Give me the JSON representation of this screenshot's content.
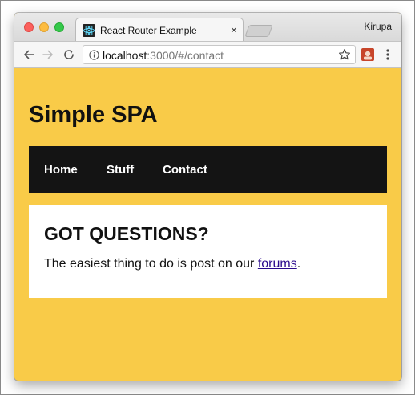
{
  "browser": {
    "tab": {
      "title": "React Router Example",
      "close_glyph": "×",
      "icon": "react-favicon-icon"
    },
    "profile_name": "Kirupa",
    "address": {
      "host": "localhost",
      "rest": ":3000/#/contact"
    },
    "icons": {
      "back": "back-arrow-icon",
      "forward": "forward-arrow-icon",
      "reload": "reload-icon",
      "info": "info-icon",
      "star": "star-icon",
      "extension": "extension-icon",
      "menu": "menu-dots-icon"
    }
  },
  "page": {
    "site_title": "Simple SPA",
    "nav": {
      "items": [
        {
          "label": "Home"
        },
        {
          "label": "Stuff"
        },
        {
          "label": "Contact"
        }
      ]
    },
    "content": {
      "heading": "GOT QUESTIONS?",
      "text_before": "The easiest thing to do is post on our ",
      "link_text": "forums",
      "text_after": "."
    }
  },
  "colors": {
    "page_background": "#f9cb48",
    "nav_background": "#141414",
    "content_background": "#ffffff",
    "link": "#2a0a8c"
  }
}
